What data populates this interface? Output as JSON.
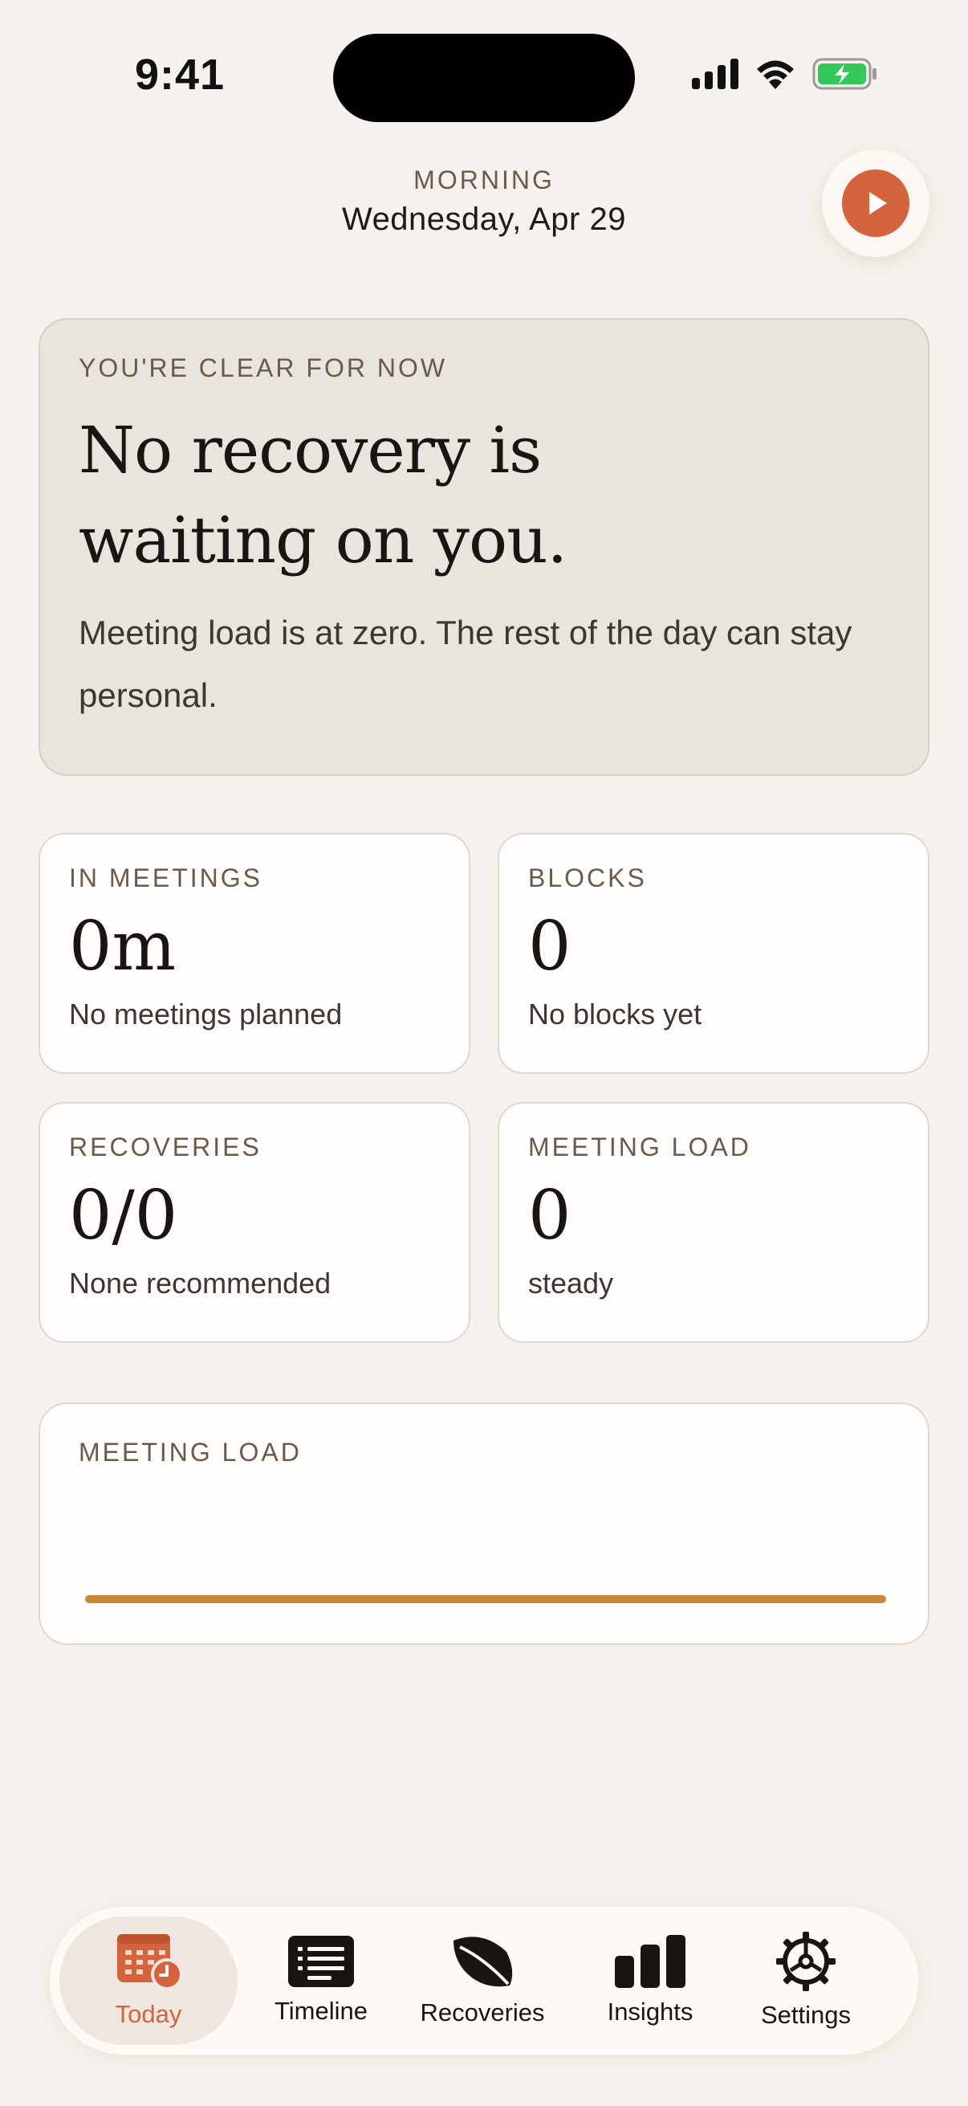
{
  "status_bar": {
    "time": "9:41"
  },
  "header": {
    "period": "MORNING",
    "date": "Wednesday, Apr 29"
  },
  "hero": {
    "eyebrow": "YOU'RE CLEAR FOR NOW",
    "title": "No recovery is waiting on you.",
    "body": "Meeting load is at zero. The rest of the day can stay personal."
  },
  "stats": [
    {
      "label": "IN MEETINGS",
      "value": "0m",
      "sub": "No meetings planned"
    },
    {
      "label": "BLOCKS",
      "value": "0",
      "sub": "No blocks yet"
    },
    {
      "label": "RECOVERIES",
      "value": "0/0",
      "sub": "None recommended"
    },
    {
      "label": "MEETING LOAD",
      "value": "0",
      "sub": "steady"
    }
  ],
  "meeting_load_card": {
    "label": "MEETING LOAD"
  },
  "tabs": [
    {
      "label": "Today",
      "icon": "calendar-clock-icon",
      "active": true
    },
    {
      "label": "Timeline",
      "icon": "list-icon",
      "active": false
    },
    {
      "label": "Recoveries",
      "icon": "leaf-icon",
      "active": false
    },
    {
      "label": "Insights",
      "icon": "bar-chart-icon",
      "active": false
    },
    {
      "label": "Settings",
      "icon": "gear-icon",
      "active": false
    }
  ],
  "colors": {
    "accent": "#d4643d",
    "background": "#f5f1ec",
    "load_line": "#c98832"
  }
}
